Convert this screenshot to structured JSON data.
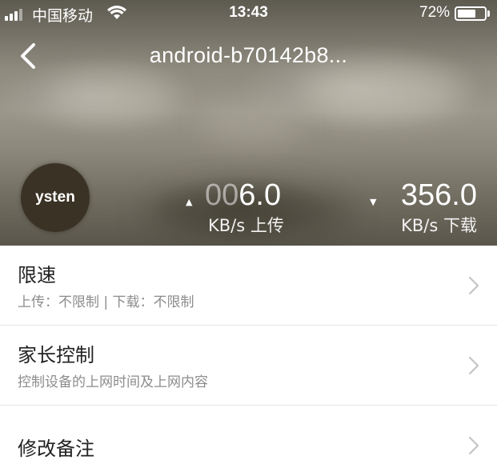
{
  "status_bar": {
    "carrier": "中国移动",
    "time": "13:43",
    "battery_percent": "72%",
    "battery_level": 0.72,
    "signal_bars_active": 3,
    "signal_bars_total": 4,
    "icons": [
      "signal-icon",
      "wifi-icon",
      "battery-icon"
    ]
  },
  "nav": {
    "back_icon": "chevron-left-icon",
    "title": "android-b70142b8..."
  },
  "device": {
    "avatar_text": "ysten",
    "avatar_color": "#3a3224"
  },
  "speeds": {
    "upload": {
      "arrow": "▲",
      "value_pad": "00",
      "value": "6.0",
      "unit": "KB/s",
      "label": "上传"
    },
    "download": {
      "arrow": "▼",
      "value": "356.0",
      "unit": "KB/s",
      "label": "下载"
    }
  },
  "menu": {
    "items": [
      {
        "title": "限速",
        "subtitle": "上传：不限制 | 下载：不限制",
        "icon": "chevron-right-icon"
      },
      {
        "title": "家长控制",
        "subtitle": "控制设备的上网时间及上网内容",
        "icon": "chevron-right-icon"
      },
      {
        "title": "修改备注",
        "subtitle": "",
        "icon": "chevron-right-icon"
      }
    ]
  },
  "colors": {
    "header_text": "#ffffff",
    "item_title": "#222222",
    "item_subtitle": "#8c8c8c",
    "chevron": "#c4c4c4",
    "divider": "#e3e3e3"
  }
}
